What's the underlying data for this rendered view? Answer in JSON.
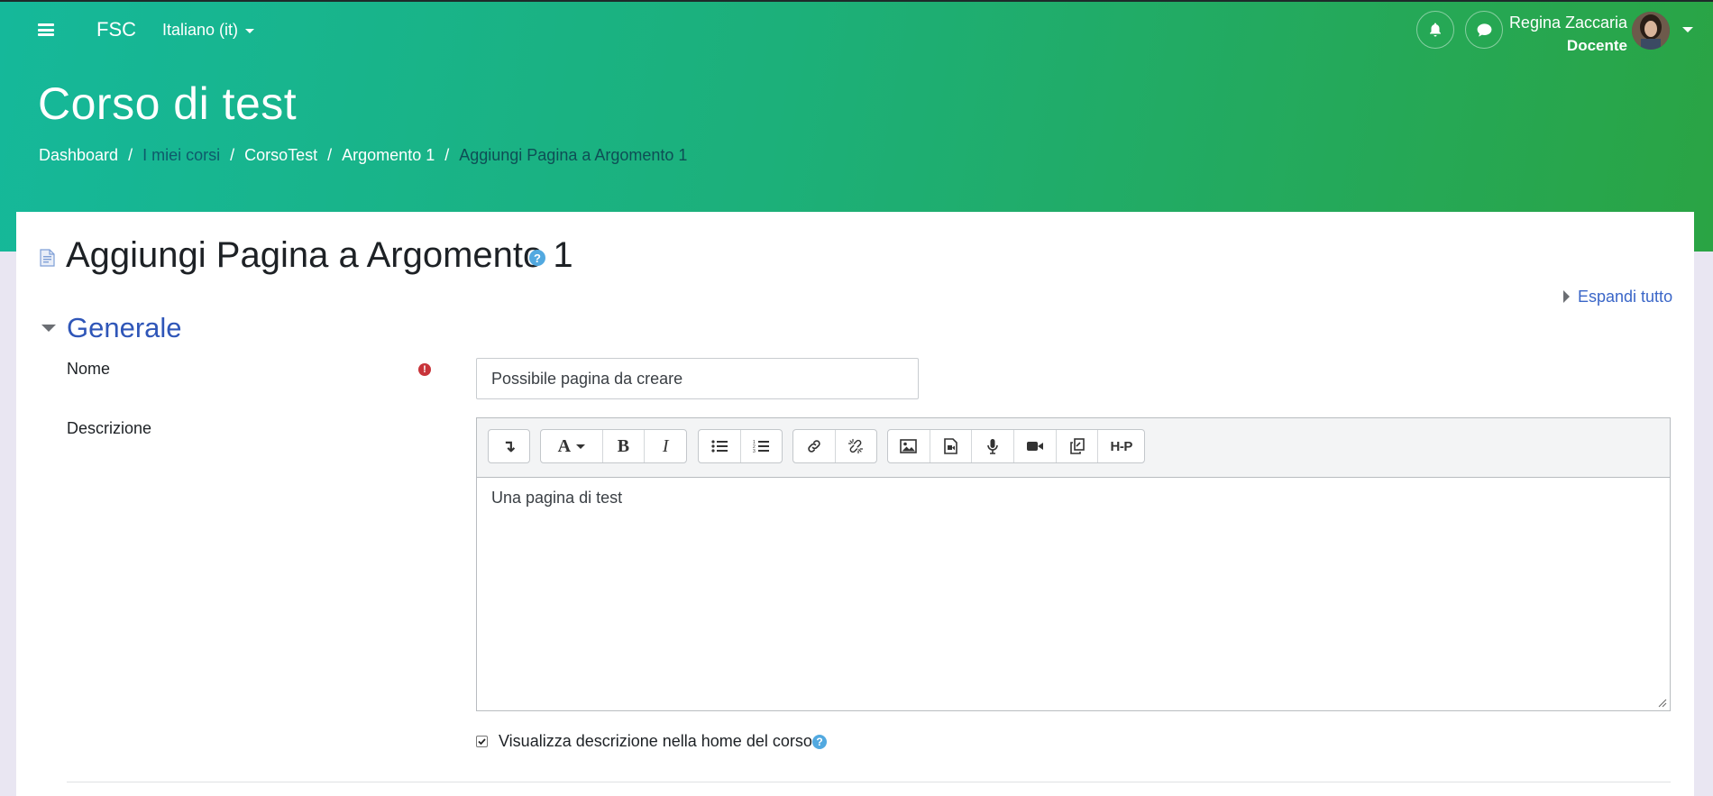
{
  "navbar": {
    "brand": "FSC",
    "language": "Italiano (it)",
    "user_name": "Regina Zaccaria",
    "user_role": "Docente",
    "icons": [
      "menu-icon",
      "bell-icon",
      "chat-icon",
      "avatar"
    ]
  },
  "header": {
    "course_title": "Corso di test",
    "breadcrumb": [
      "Dashboard",
      "I miei corsi",
      "CorsoTest",
      "Argomento 1",
      "Aggiungi Pagina a Argomento 1"
    ],
    "separator": "/"
  },
  "form": {
    "page_heading": "Aggiungi Pagina a Argomento 1",
    "help_glyph": "?",
    "expand_all": "Espandi tutto",
    "section_title": "Generale",
    "name_label": "Nome",
    "name_value": "Possibile pagina da creare",
    "required_glyph": "!",
    "description_label": "Descrizione",
    "description_text": "Una pagina di test",
    "show_description_label": "Visualizza descrizione nella home del corso",
    "show_description_checked": true
  },
  "editor_toolbar": {
    "groups": [
      [
        "expand-toolbar-icon"
      ],
      [
        "font-style-icon",
        "bold-icon",
        "italic-icon"
      ],
      [
        "unordered-list-icon",
        "ordered-list-icon"
      ],
      [
        "link-icon",
        "unlink-icon"
      ],
      [
        "image-icon",
        "media-icon",
        "record-audio-icon",
        "record-video-icon",
        "manage-files-icon",
        "h5p-icon"
      ]
    ],
    "font_glyph": "A",
    "bold_glyph": "B",
    "italic_glyph": "I",
    "expand_glyph": "↴",
    "h5p_glyph": "H-P"
  },
  "colors": {
    "hero_gradient_start": "#15b89a",
    "hero_gradient_end": "#2aa444",
    "link": "#3a66c8",
    "section_title": "#2f56b8",
    "help": "#52a9e0",
    "required": "#c8343a"
  }
}
